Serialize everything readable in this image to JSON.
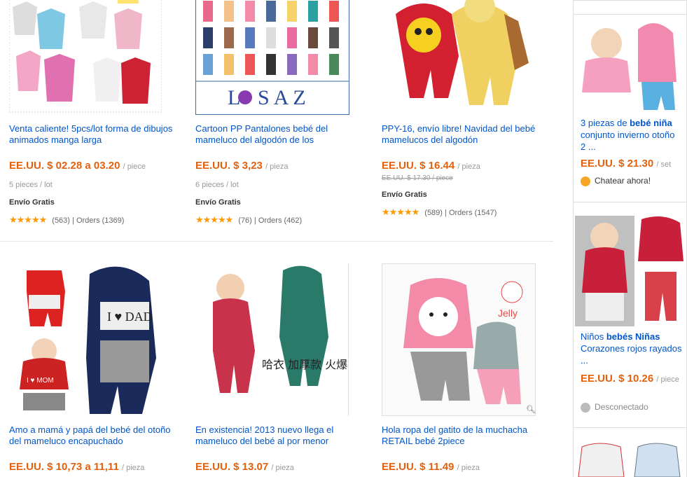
{
  "products": [
    {
      "title": "Venta caliente! 5pcs/lot forma de dibujos animados manga larga",
      "price": "EE.UU. $ 02.28 a 03.20",
      "unit": "/ piece",
      "lot": "5 pieces / lot",
      "shipping": "Envío Gratis",
      "reviews": "(563)",
      "orders": "Orders (1369)",
      "image": "onesies-photo"
    },
    {
      "title": "Cartoon PP Pantalones bebé del mameluco del algodón de los",
      "price": "EE.UU. $ 3,23",
      "unit": "/ pieza",
      "lot": "6 pieces / lot",
      "shipping": "Envío Gratis",
      "reviews": "(76)",
      "orders": "Orders (462)",
      "image": "pants-grid-photo",
      "brand": "LSAZ"
    },
    {
      "title": "PPY-16, envío libre! Navidad del bebé mamelucos del algodón",
      "price": "EE.UU. $ 16.44",
      "unit": "/ pieza",
      "old_price": "EE.UU. $ 17.30 / piece",
      "shipping": "Envío Gratis",
      "reviews": "(589)",
      "orders": "Orders (1547)",
      "image": "costume-photo"
    },
    {
      "title": "Amo a mamá y papá del bebé del otoño del mameluco encapuchado",
      "price": "EE.UU. $ 10,73 a 11,11",
      "unit": "/ pieza",
      "image": "dad-romper-photo",
      "badge_mom": "I ♥ MOM",
      "badge_dad": "I ♥ DAD"
    },
    {
      "title": "En existencia! 2013 nuevo llega el mameluco del bebé al por menor",
      "price": "EE.UU. $ 13.07",
      "unit": "/ pieza",
      "image": "snowsuit-photo",
      "caption": "哈衣 加厚款 火爆抢购"
    },
    {
      "title": "Hola ropa del gatito de la muchacha RETAIL bebé 2piece",
      "price": "EE.UU. $ 11.49",
      "unit": "/ pieza",
      "image": "hello-kitty-photo"
    }
  ],
  "sidebar": [
    {
      "title_pre": "3 piezas de ",
      "title_bold": "bebé niña",
      "title_post": " conjunto invierno otoño 2 ...",
      "price": "EE.UU. $ 21.30",
      "unit": "/ set",
      "status": "Chatear ahora!",
      "status_color": "#f5a623"
    },
    {
      "title_pre": "Niños ",
      "title_bold": "bebés Niñas",
      "title_post": " Corazones rojos rayados ...",
      "price": "EE.UU. $ 10.26",
      "unit": "/ piece",
      "status": "Desconectado",
      "status_color": "#bbbbbb"
    }
  ],
  "colors": {
    "link": "#0055cc",
    "price": "#e4600c",
    "star": "#ff9900"
  }
}
